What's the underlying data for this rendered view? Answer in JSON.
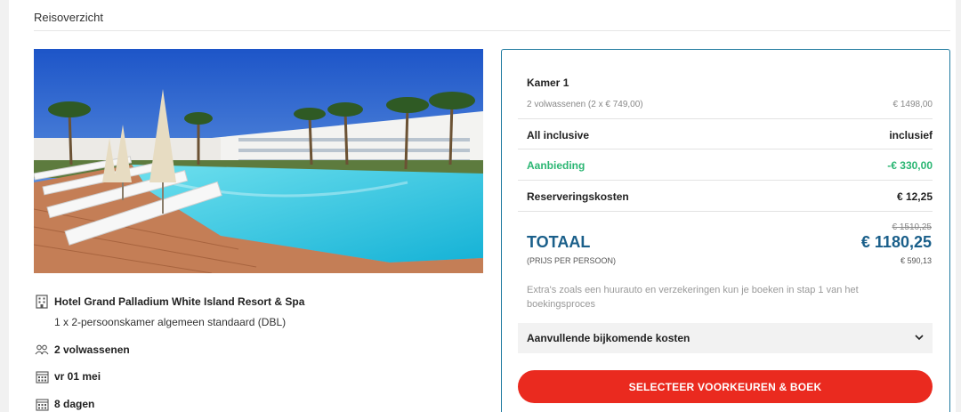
{
  "section_title": "Reisoverzicht",
  "hotel": {
    "name": "Hotel Grand Palladium White Island Resort & Spa",
    "room": "1 x 2-persoonskamer algemeen standaard (DBL)",
    "guests": "2 volwassenen",
    "date": "vr 01 mei",
    "duration": "8 dagen"
  },
  "price": {
    "room_heading": "Kamer 1",
    "room_detail": "2 volwassenen (2 x € 749,00)",
    "room_amount": "€ 1498,00",
    "board_label": "All inclusive",
    "board_value": "inclusief",
    "offer_label": "Aanbieding",
    "offer_value": "-€ 330,00",
    "booking_fee_label": "Reserveringskosten",
    "booking_fee_value": "€ 12,25",
    "old_total": "€ 1510,25",
    "total_label": "TOTAAL",
    "total_value": "€ 1180,25",
    "per_person_label": "(PRIJS PER PERSOON)",
    "per_person_value": "€ 590,13",
    "extras_note": "Extra's zoals een huurauto en verzekeringen kun je boeken in stap 1 van het boekingsproces",
    "additional_costs_label": "Aanvullende bijkomende kosten",
    "book_button": "SELECTEER VOORKEUREN & BOEK"
  },
  "colors": {
    "accent_blue": "#1a5f8a",
    "offer_green": "#2bb673",
    "button_red": "#ea2a1f"
  },
  "icons": {
    "hotel": "building-icon",
    "guests": "people-icon",
    "date": "calendar-icon",
    "duration": "calendar-icon",
    "accordion": "chevron-down-icon"
  }
}
